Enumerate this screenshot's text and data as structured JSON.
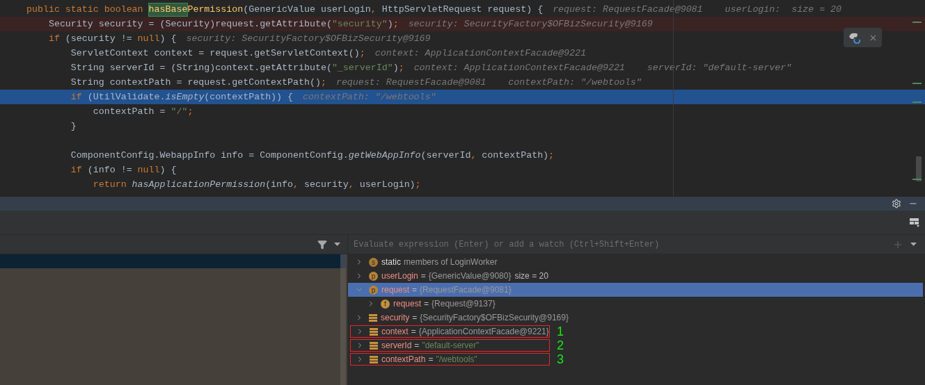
{
  "editor": {
    "lines": [
      {
        "kind": "normal",
        "tokens": [
          {
            "kind": "kw",
            "text": "public static boolean "
          },
          {
            "kind": "match",
            "text": "hasBase"
          },
          {
            "kind": "decl",
            "text": "Permission"
          },
          {
            "kind": "plain",
            "text": "(GenericValue userLogin"
          },
          {
            "kind": "punct",
            "text": ","
          },
          {
            "kind": "plain",
            "text": " HttpServletRequest request) {"
          },
          {
            "kind": "hint",
            "text": "request: RequestFacade@9081    userLogin:  size = 20"
          }
        ]
      },
      {
        "kind": "error",
        "tokens": [
          {
            "kind": "plain",
            "text": "    Security security = (Security)request.getAttribute("
          },
          {
            "kind": "str",
            "text": "\"security\""
          },
          {
            "kind": "plain",
            "text": ")"
          },
          {
            "kind": "punct",
            "text": ";"
          },
          {
            "kind": "hint",
            "text": "security: SecurityFactory$OFBizSecurity@9169"
          }
        ]
      },
      {
        "kind": "normal",
        "tokens": [
          {
            "kind": "kw",
            "text": "    if"
          },
          {
            "kind": "plain",
            "text": " (security != "
          },
          {
            "kind": "kw",
            "text": "null"
          },
          {
            "kind": "plain",
            "text": ") {"
          },
          {
            "kind": "hint",
            "text": "security: SecurityFactory$OFBizSecurity@9169"
          }
        ]
      },
      {
        "kind": "normal",
        "tokens": [
          {
            "kind": "plain",
            "text": "        ServletContext context = request.getServletContext()"
          },
          {
            "kind": "punct",
            "text": ";"
          },
          {
            "kind": "hint",
            "text": "context: ApplicationContextFacade@9221"
          }
        ]
      },
      {
        "kind": "normal",
        "tokens": [
          {
            "kind": "plain",
            "text": "        String serverId = (String)context.getAttribute("
          },
          {
            "kind": "str",
            "text": "\"_serverId\""
          },
          {
            "kind": "plain",
            "text": ")"
          },
          {
            "kind": "punct",
            "text": ";"
          },
          {
            "kind": "hint",
            "text": "context: ApplicationContextFacade@9221    serverId: \"default-server\""
          }
        ]
      },
      {
        "kind": "normal",
        "tokens": [
          {
            "kind": "plain",
            "text": "        String contextPath = request.getContextPath()"
          },
          {
            "kind": "punct",
            "text": ";"
          },
          {
            "kind": "hint",
            "text": "request: RequestFacade@9081    contextPath: \"/webtools\""
          }
        ]
      },
      {
        "kind": "current",
        "tokens": [
          {
            "kind": "kw",
            "text": "        if"
          },
          {
            "kind": "plain",
            "text": " (UtilValidate."
          },
          {
            "kind": "call",
            "text": "isEmpty"
          },
          {
            "kind": "plain",
            "text": "(contextPath)) {"
          },
          {
            "kind": "hint",
            "text": "contextPath: \"/webtools\""
          }
        ]
      },
      {
        "kind": "normal",
        "tokens": [
          {
            "kind": "plain",
            "text": "            contextPath = "
          },
          {
            "kind": "str",
            "text": "\"/\""
          },
          {
            "kind": "punct",
            "text": ";"
          }
        ]
      },
      {
        "kind": "normal",
        "tokens": [
          {
            "kind": "plain",
            "text": "        }"
          }
        ]
      },
      {
        "kind": "blank"
      },
      {
        "kind": "normal",
        "tokens": [
          {
            "kind": "plain",
            "text": "        ComponentConfig.WebappInfo info = ComponentConfig."
          },
          {
            "kind": "call",
            "text": "getWebAppInfo"
          },
          {
            "kind": "plain",
            "text": "(serverId"
          },
          {
            "kind": "punct",
            "text": ","
          },
          {
            "kind": "plain",
            "text": " contextPath)"
          },
          {
            "kind": "punct",
            "text": ";"
          }
        ]
      },
      {
        "kind": "normal",
        "tokens": [
          {
            "kind": "kw",
            "text": "        if"
          },
          {
            "kind": "plain",
            "text": " (info != "
          },
          {
            "kind": "kw",
            "text": "null"
          },
          {
            "kind": "plain",
            "text": ") {"
          }
        ]
      },
      {
        "kind": "normal",
        "tokens": [
          {
            "kind": "kw",
            "text": "            return "
          },
          {
            "kind": "call",
            "text": "hasApplicationPermission"
          },
          {
            "kind": "plain",
            "text": "(info"
          },
          {
            "kind": "punct",
            "text": ","
          },
          {
            "kind": "plain",
            "text": " security"
          },
          {
            "kind": "punct",
            "text": ","
          },
          {
            "kind": "plain",
            "text": " userLogin)"
          },
          {
            "kind": "punct",
            "text": ";"
          }
        ]
      }
    ]
  },
  "debugger": {
    "evaluate": {
      "placeholder": "Evaluate expression (Enter) or add a watch (Ctrl+Shift+Enter)"
    },
    "frames": [
      {
        "selected": true
      }
    ],
    "variables": [
      {
        "kind": "static",
        "badge": "s",
        "name": "static",
        "note": "members of LoginWorker",
        "expanded": false,
        "selected": false
      },
      {
        "kind": "param",
        "badge": "p",
        "name": "userLogin",
        "equals": "=",
        "value": {
          "kind": "object",
          "text": "{GenericValue@9080}"
        },
        "extra": "size = 20",
        "expanded": false,
        "selected": false
      },
      {
        "kind": "param",
        "badge": "p",
        "name": "request",
        "equals": "=",
        "value": {
          "kind": "object",
          "text": "{RequestFacade@9081}"
        },
        "expanded": true,
        "selected": true,
        "children": [
          {
            "kind": "field",
            "badge": "f",
            "name": "request",
            "equals": "=",
            "value": {
              "kind": "object",
              "text": "{Request@9137}"
            },
            "expanded": false,
            "selected": false
          }
        ]
      },
      {
        "kind": "local",
        "name": "security",
        "equals": "=",
        "value": {
          "kind": "object",
          "text": "{SecurityFactory$OFBizSecurity@9169}"
        },
        "expanded": false,
        "selected": false
      },
      {
        "kind": "local",
        "name": "context",
        "equals": "=",
        "value": {
          "kind": "object",
          "text": "{ApplicationContextFacade@9221}"
        },
        "expanded": false,
        "selected": false,
        "callout": "1"
      },
      {
        "kind": "local",
        "name": "serverId",
        "equals": "=",
        "value": {
          "kind": "string",
          "text": "\"default-server\""
        },
        "expanded": false,
        "selected": false,
        "callout": "2"
      },
      {
        "kind": "local",
        "name": "contextPath",
        "equals": "=",
        "value": {
          "kind": "string",
          "text": "\"/webtools\""
        },
        "expanded": false,
        "selected": false,
        "callout": "3"
      }
    ]
  }
}
